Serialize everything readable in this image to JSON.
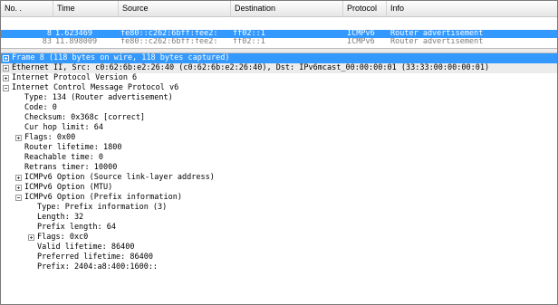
{
  "packet_list": {
    "columns": [
      "No. .",
      "Time",
      "Source",
      "Destination",
      "Protocol",
      "Info"
    ],
    "rows": [
      {
        "no": "8",
        "time": "1.623469",
        "source": "fe80::c262:6bff:fee2:",
        "destination": "ff02::1",
        "protocol": "ICMPv6",
        "info": "Router advertisement",
        "selected": true
      },
      {
        "no": "83",
        "time": "11.898009",
        "source": "fe80::c262:6bff:fee2:",
        "destination": "ff02::1",
        "protocol": "ICMPv6",
        "info": "Router advertisement",
        "selected": false
      }
    ]
  },
  "details": {
    "frame": "Frame 8 (118 bytes on wire, 118 bytes captured)",
    "ethernet": "Ethernet II, Src: c0:62:6b:e2:26:40 (c0:62:6b:e2:26:40), Dst: IPv6mcast_00:00:00:01 (33:33:00:00:00:01)",
    "ipv6": "Internet Protocol Version 6",
    "icmpv6": "Internet Control Message Protocol v6",
    "type": "Type: 134 (Router advertisement)",
    "code": "Code: 0",
    "checksum": "Checksum: 0x368c [correct]",
    "cur_hop": "Cur hop limit: 64",
    "flags": "Flags: 0x00",
    "router_lifetime": "Router lifetime: 1800",
    "reachable": "Reachable time: 0",
    "retrans": "Retrans timer: 10000",
    "opt_source": "ICMPv6 Option (Source link-layer address)",
    "opt_mtu": "ICMPv6 Option (MTU)",
    "opt_prefix": "ICMPv6 Option (Prefix information)",
    "p_type": "Type: Prefix information (3)",
    "p_length": "Length: 32",
    "p_prefix_len": "Prefix length: 64",
    "p_flags": "Flags: 0xc0",
    "p_valid": "Valid lifetime: 86400",
    "p_preferred": "Preferred lifetime: 86400",
    "p_prefix": "Prefix: 2404:a8:400:1600::"
  },
  "colors": {
    "selection": "#3399ff",
    "header_bg": "#e6e6e6"
  }
}
